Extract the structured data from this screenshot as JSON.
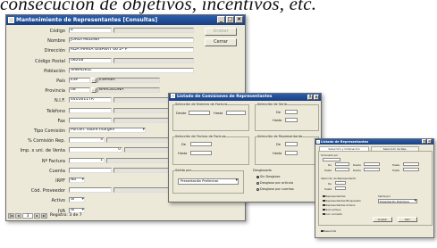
{
  "background_text": "consecución de objetivos, incentivos, etc.",
  "colors": {
    "titlebar": "#1f4a94",
    "window": "#ece9d8",
    "field": "#ffffff"
  },
  "main_window": {
    "title": "Mantenimiento de Representantes [Consultas]",
    "title_buttons": [
      "_",
      "□",
      "×"
    ],
    "fields": [
      {
        "label": "Código",
        "value": "2",
        "kind": "short"
      },
      {
        "label": "Nombre",
        "value": "JORDI MEDINA",
        "kind": "long"
      },
      {
        "label": "Dirección",
        "value": "RDA MARIA GISPERT 46 2º P",
        "kind": "long"
      },
      {
        "label": "Código Postal",
        "value": "08208",
        "kind": "short"
      },
      {
        "label": "Población",
        "value": "SABADELL",
        "kind": "long"
      },
      {
        "label": "País",
        "value": "ESP",
        "extra": "ESPAÑA",
        "kind": "code"
      },
      {
        "label": "Provincia",
        "value": "08",
        "extra": "BARCELONA",
        "kind": "code"
      },
      {
        "label": "N.I.F.",
        "value": "44056117R",
        "kind": "short"
      },
      {
        "label": "Teléfono",
        "value": "",
        "kind": "short"
      },
      {
        "label": "Fax",
        "value": "",
        "kind": "short"
      },
      {
        "label": "Tipo Comisión",
        "value": "Porcen. sobre margen",
        "kind": "combo"
      },
      {
        "label": "% Comisión Rep.",
        "value": "3",
        "kind": "num"
      },
      {
        "label": "Imp. x uni. de Venta",
        "value": "0",
        "kind": "num2"
      },
      {
        "label": "Nº Factura",
        "value": "1",
        "kind": "num"
      },
      {
        "label": "Cuenta",
        "value": "",
        "kind": "short"
      },
      {
        "label": "IRPF",
        "value": "No",
        "kind": "yn"
      },
      {
        "label": "Cód. Proveedor",
        "value": "",
        "kind": "short"
      },
      {
        "label": "Activo",
        "value": "Sí",
        "kind": "yn"
      },
      {
        "label": "IVA",
        "value": "Sí",
        "kind": "yn"
      }
    ],
    "buttons": {
      "grabar": "Grabar",
      "cerrar": "Cerrar"
    },
    "nav": {
      "current": "3",
      "text": "Registro: 3 de 7"
    }
  },
  "list_window": {
    "title": "Listado de Comisiones de Representantes",
    "group_invoice": {
      "label": "Selección de Número de Factura",
      "desde": "Desde",
      "hasta": "Hasta"
    },
    "group_serie": {
      "label": "Selección de Serie",
      "de": "De",
      "hasta": "Hasta"
    },
    "group_dates": {
      "label": "Selección de Fechas de Factura",
      "de": "De",
      "hasta": "Hasta"
    },
    "group_rep": {
      "label": "Selección de Representante",
      "de": "De",
      "hasta": "Hasta"
    },
    "output": {
      "label": "Salida por",
      "value": "Presentación Preliminar"
    },
    "breakdown": {
      "label": "Desglosado",
      "options": [
        "Sin Desglose",
        "Desglose por artículo",
        "Desglose por cuentas"
      ],
      "selected": 0
    }
  },
  "list_window_small": {
    "title": "Listado de Representantes",
    "tabs": [
      "Selección y Ordenación",
      "Selección de Rep."
    ],
    "order_label": "Ordenado por",
    "range_label": "Selección de Representante",
    "de": "De",
    "hasta": "Hasta",
    "desde": "Desde",
    "checks": [
      "Representantes",
      "Representantes Bloqueados",
      "Representantes Activos",
      "Solo activos",
      "Con comisión"
    ],
    "output_label": "Salida por",
    "output_value": "Presentación Preliminar",
    "bottom_check": "Resumido",
    "buttons": {
      "accept": "Aceptar",
      "cancel": "Salir"
    }
  }
}
